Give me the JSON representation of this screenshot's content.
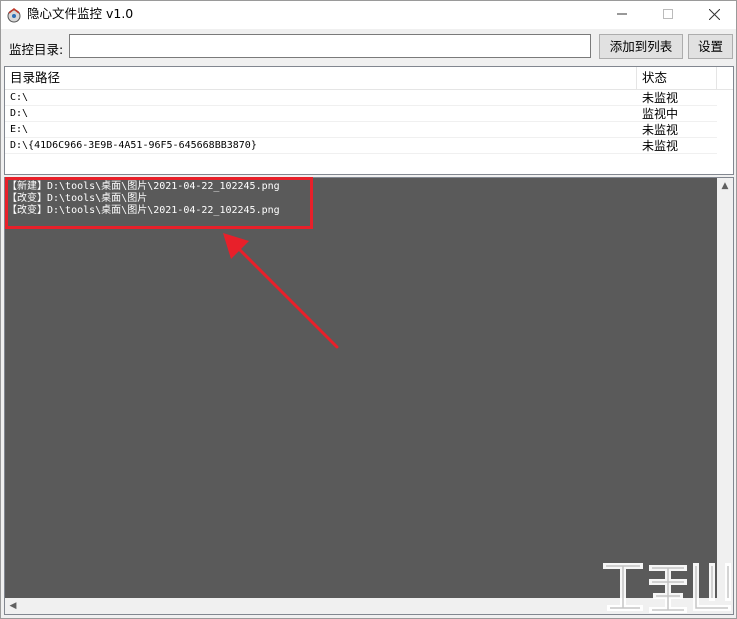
{
  "window": {
    "title": "隐心文件监控 v1.0",
    "controls": {
      "minimize": "—",
      "maximize": "☐",
      "close": "✕"
    }
  },
  "toolbar": {
    "dir_label": "监控目录:",
    "dir_value": "",
    "add_button": "添加到列表",
    "settings_button": "设置"
  },
  "listview": {
    "columns": [
      "目录路径",
      "状态"
    ],
    "rows": [
      {
        "path": "C:\\",
        "status": "未监视"
      },
      {
        "path": "D:\\",
        "status": "监视中"
      },
      {
        "path": "E:\\",
        "status": "未监视"
      },
      {
        "path": "D:\\{41D6C966-3E9B-4A51-96F5-645668BB3870}",
        "status": "未监视"
      }
    ]
  },
  "log": {
    "lines": [
      "【新建】D:\\tools\\桌面\\图片\\2021-04-22_102245.png",
      "【改变】D:\\tools\\桌面\\图片",
      "【改变】D:\\tools\\桌面\\图片\\2021-04-22_102245.png"
    ]
  },
  "colors": {
    "log_bg": "#5a5a5a",
    "annotation": "#e8202a"
  },
  "icons": {
    "app": "app-logo-icon",
    "scroll_up": "scroll-up-icon",
    "scroll_left": "scroll-left-icon"
  }
}
